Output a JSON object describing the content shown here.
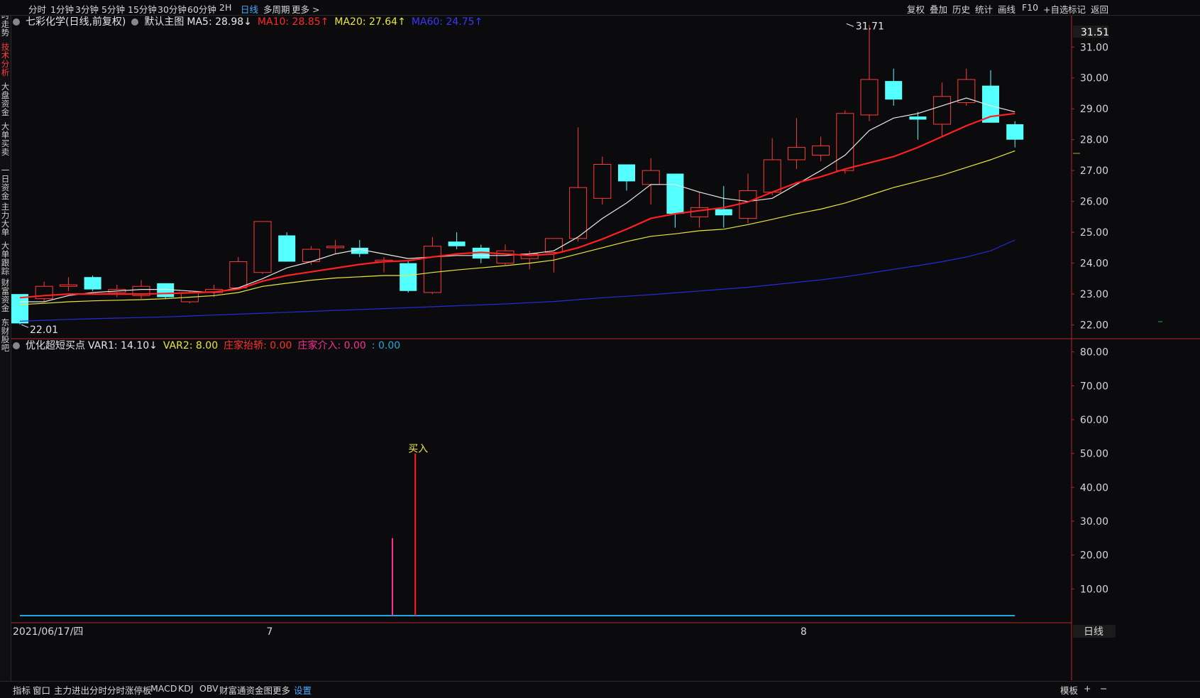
{
  "toolbar": {
    "periods": [
      "分时",
      "1分钟",
      "3分钟",
      "5分钟",
      "15分钟",
      "30分钟",
      "60分钟",
      "2H",
      "日线",
      "多周期",
      "更多 >"
    ],
    "active_period": "日线",
    "right": [
      "复权",
      "叠加",
      "历史",
      "统计",
      "画线",
      "F10",
      "+自选",
      "标记",
      "返回"
    ]
  },
  "sidebar": {
    "tabs": [
      "分时走势",
      "技术分析",
      "大盘资金",
      "大单买卖",
      "一日资金",
      "主力大单",
      "大单跟踪",
      "财富资金",
      "东财股吧"
    ],
    "active": "技术分析"
  },
  "main_legend": {
    "title": "七彩化学(日线,前复权)",
    "indicator": "默认主图",
    "ma5": "MA5: 28.98↓",
    "ma10": "MA10: 28.85↑",
    "ma20": "MA20: 27.64↑",
    "ma60": "MA60: 24.75↑"
  },
  "sub_legend": {
    "title": "优化超短买点",
    "var1": "VAR1: 14.10↓",
    "var2": "VAR2: 8.00",
    "lift": "庄家抬轿: 0.00",
    "enter": "庄家介入: 0.00",
    "last": ": 0.00"
  },
  "bottom_bar": {
    "items": [
      "指标",
      "窗口",
      "主力进出分时",
      "分时涨停板",
      "MACD",
      "KDJ",
      "OBV",
      "财富通资金图",
      "更多",
      "设置"
    ],
    "right": [
      "模板",
      "+",
      "−"
    ],
    "period_label": "日线"
  },
  "colors": {
    "up": "#ff3b3b",
    "down": "#54ffff",
    "ma5": "#e8e8e8",
    "ma10": "#ff2020",
    "ma20": "#e8e83a",
    "ma60": "#2a2ad8",
    "buy": "#ff2020",
    "var1": "#ff2d95",
    "zero_line": "#21a8e0",
    "axis": "#b4262a"
  },
  "chart_data": [
    {
      "type": "candlestick",
      "title": "七彩化学(日线,前复权)",
      "y_ticks": [
        "31.00",
        "30.00",
        "29.00",
        "28.00",
        "27.00",
        "26.00",
        "25.00",
        "24.00",
        "23.00",
        "22.00"
      ],
      "ylim": [
        21.6,
        31.65
      ],
      "current_price_label": "31.51",
      "x_labels": [
        {
          "label": "2021/06/17/四",
          "index": 0
        },
        {
          "label": "7",
          "index": 10
        },
        {
          "label": "8",
          "index": 32
        }
      ],
      "annotations": [
        {
          "text": "31.71",
          "index": 34,
          "value": 31.71
        },
        {
          "text": "22.01",
          "index": 0,
          "value": 22.01
        }
      ],
      "candles": [
        {
          "o": 23.0,
          "h": 23.0,
          "l": 22.01,
          "c": 22.05
        },
        {
          "o": 22.85,
          "h": 23.4,
          "l": 22.75,
          "c": 23.25
        },
        {
          "o": 23.25,
          "h": 23.55,
          "l": 23.1,
          "c": 23.3
        },
        {
          "o": 23.55,
          "h": 23.6,
          "l": 23.1,
          "c": 23.15
        },
        {
          "o": 23.05,
          "h": 23.3,
          "l": 22.9,
          "c": 23.15
        },
        {
          "o": 22.95,
          "h": 23.45,
          "l": 22.85,
          "c": 23.25
        },
        {
          "o": 23.35,
          "h": 23.35,
          "l": 22.85,
          "c": 22.9
        },
        {
          "o": 22.75,
          "h": 23.1,
          "l": 22.7,
          "c": 23.05
        },
        {
          "o": 23.05,
          "h": 23.3,
          "l": 22.9,
          "c": 23.15
        },
        {
          "o": 23.2,
          "h": 24.2,
          "l": 23.15,
          "c": 24.05
        },
        {
          "o": 23.7,
          "h": 25.05,
          "l": 23.65,
          "c": 25.35
        },
        {
          "o": 24.9,
          "h": 25.0,
          "l": 24.05,
          "c": 24.05
        },
        {
          "o": 24.05,
          "h": 24.55,
          "l": 23.95,
          "c": 24.45
        },
        {
          "o": 24.5,
          "h": 24.75,
          "l": 24.3,
          "c": 24.55
        },
        {
          "o": 24.5,
          "h": 24.75,
          "l": 24.2,
          "c": 24.3
        },
        {
          "o": 24.05,
          "h": 24.2,
          "l": 23.7,
          "c": 24.1
        },
        {
          "o": 24.0,
          "h": 24.1,
          "l": 23.05,
          "c": 23.1
        },
        {
          "o": 23.05,
          "h": 24.85,
          "l": 23.0,
          "c": 24.55
        },
        {
          "o": 24.7,
          "h": 25.0,
          "l": 24.45,
          "c": 24.55
        },
        {
          "o": 24.5,
          "h": 24.6,
          "l": 24.0,
          "c": 24.15
        },
        {
          "o": 24.0,
          "h": 24.6,
          "l": 23.95,
          "c": 24.4
        },
        {
          "o": 24.15,
          "h": 24.4,
          "l": 23.8,
          "c": 24.3
        },
        {
          "o": 24.35,
          "h": 24.8,
          "l": 23.7,
          "c": 24.8
        },
        {
          "o": 24.8,
          "h": 28.4,
          "l": 24.7,
          "c": 26.45
        },
        {
          "o": 26.1,
          "h": 27.45,
          "l": 25.9,
          "c": 27.2
        },
        {
          "o": 27.2,
          "h": 27.2,
          "l": 26.35,
          "c": 26.65
        },
        {
          "o": 26.55,
          "h": 27.4,
          "l": 25.9,
          "c": 27.0
        },
        {
          "o": 26.9,
          "h": 26.9,
          "l": 25.15,
          "c": 25.6
        },
        {
          "o": 25.5,
          "h": 26.3,
          "l": 25.15,
          "c": 25.8
        },
        {
          "o": 25.75,
          "h": 26.5,
          "l": 25.15,
          "c": 25.55
        },
        {
          "o": 25.45,
          "h": 26.9,
          "l": 25.3,
          "c": 26.35
        },
        {
          "o": 26.3,
          "h": 28.05,
          "l": 26.2,
          "c": 27.35
        },
        {
          "o": 27.35,
          "h": 28.7,
          "l": 27.05,
          "c": 27.75
        },
        {
          "o": 27.5,
          "h": 28.1,
          "l": 27.3,
          "c": 27.8
        },
        {
          "o": 27.0,
          "h": 28.95,
          "l": 26.9,
          "c": 28.85
        },
        {
          "o": 28.8,
          "h": 31.71,
          "l": 28.6,
          "c": 29.95
        },
        {
          "o": 29.9,
          "h": 30.3,
          "l": 29.1,
          "c": 29.3
        },
        {
          "o": 28.75,
          "h": 28.9,
          "l": 28.0,
          "c": 28.65
        },
        {
          "o": 28.5,
          "h": 29.85,
          "l": 28.1,
          "c": 29.4
        },
        {
          "o": 29.2,
          "h": 30.3,
          "l": 29.1,
          "c": 29.95
        },
        {
          "o": 29.75,
          "h": 30.25,
          "l": 28.65,
          "c": 28.55
        },
        {
          "o": 28.5,
          "h": 28.6,
          "l": 27.75,
          "c": 28.0
        }
      ],
      "series": [
        {
          "name": "MA5",
          "values": [
            22.75,
            22.75,
            22.95,
            23.05,
            23.1,
            23.15,
            23.15,
            23.1,
            23.05,
            23.2,
            23.5,
            23.85,
            24.05,
            24.3,
            24.45,
            24.3,
            24.15,
            24.2,
            24.25,
            24.25,
            24.25,
            24.3,
            24.4,
            24.85,
            25.45,
            25.95,
            26.55,
            26.55,
            26.3,
            26.1,
            26.0,
            26.1,
            26.55,
            27.0,
            27.5,
            28.3,
            28.7,
            28.85,
            29.1,
            29.35,
            29.1,
            28.9
          ]
        },
        {
          "name": "MA10",
          "values": [
            22.88,
            22.95,
            23.0,
            23.0,
            23.0,
            23.0,
            23.02,
            23.04,
            23.07,
            23.16,
            23.42,
            23.6,
            23.72,
            23.84,
            23.96,
            24.05,
            24.08,
            24.2,
            24.3,
            24.35,
            24.3,
            24.25,
            24.3,
            24.5,
            24.78,
            25.1,
            25.45,
            25.6,
            25.7,
            25.8,
            25.98,
            26.3,
            26.6,
            26.8,
            27.05,
            27.25,
            27.45,
            27.75,
            28.1,
            28.45,
            28.75,
            28.85
          ]
        },
        {
          "name": "MA20",
          "values": [
            22.66,
            22.7,
            22.75,
            22.78,
            22.8,
            22.82,
            22.85,
            22.9,
            22.95,
            23.05,
            23.25,
            23.35,
            23.45,
            23.52,
            23.56,
            23.6,
            23.6,
            23.7,
            23.78,
            23.85,
            23.92,
            24.0,
            24.1,
            24.3,
            24.5,
            24.7,
            24.87,
            24.95,
            25.05,
            25.1,
            25.25,
            25.42,
            25.6,
            25.75,
            25.95,
            26.2,
            26.45,
            26.65,
            26.85,
            27.1,
            27.35,
            27.64
          ]
        },
        {
          "name": "MA60",
          "values": [
            22.12,
            22.15,
            22.18,
            22.2,
            22.22,
            22.24,
            22.26,
            22.29,
            22.32,
            22.35,
            22.38,
            22.41,
            22.44,
            22.47,
            22.5,
            22.53,
            22.56,
            22.59,
            22.62,
            22.65,
            22.68,
            22.72,
            22.76,
            22.82,
            22.88,
            22.93,
            22.98,
            23.04,
            23.1,
            23.16,
            23.22,
            23.3,
            23.38,
            23.46,
            23.56,
            23.68,
            23.8,
            23.92,
            24.05,
            24.2,
            24.4,
            24.75
          ]
        }
      ]
    },
    {
      "type": "bar",
      "title": "优化超短买点",
      "y_ticks": [
        "80.00",
        "70.00",
        "60.00",
        "50.00",
        "40.00",
        "30.00",
        "20.00",
        "10.00"
      ],
      "ylim": [
        0,
        83.5
      ],
      "signals": [
        {
          "name": "VAR1",
          "index": 15,
          "value": 25
        },
        {
          "name": "买入",
          "index": 16,
          "value": 50
        }
      ],
      "buy_label": "买入",
      "zero_line_range": [
        0,
        41
      ]
    }
  ]
}
